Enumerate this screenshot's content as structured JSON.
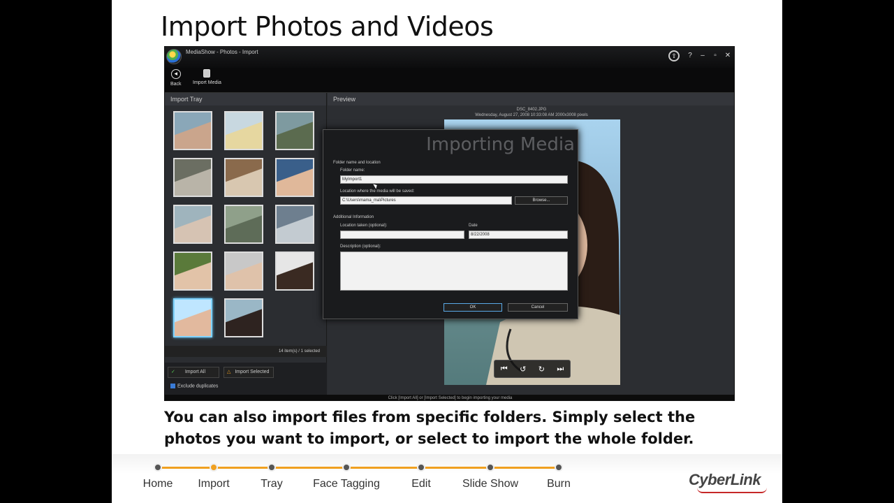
{
  "slide": {
    "title": "Import Photos and Videos"
  },
  "window": {
    "title": "MediaShow - Photos - Import",
    "controls": {
      "help": "?",
      "minimize": "–",
      "restore": "▫",
      "close": "✕"
    }
  },
  "toolbar": {
    "back_label": "Back",
    "import_media_label": "Import Media"
  },
  "tray": {
    "header": "Import Tray",
    "status": "14 item(s) / 1 selected",
    "import_all": "Import All",
    "import_selected": "Import Selected",
    "exclude_duplicates": "Exclude duplicates",
    "exclude_checked": true,
    "selected_index": 12
  },
  "preview": {
    "header": "Preview",
    "filename": "DSC_8402.JPG",
    "fileinfo": "Wednesday, August 27, 2008 10:33:08 AM 2000x3008 pixels",
    "hint": "Click [Import All] or [Import Selected] to begin importing your media"
  },
  "dialog": {
    "title": "Importing Media",
    "section_folder": "Folder name and location",
    "folder_name_label": "Folder name:",
    "folder_name_value": "MyImport1",
    "location_label": "Location where the media will be saved:",
    "location_value": "C:\\Users\\mama_ma\\Pictures",
    "browse": "Browse...",
    "section_additional": "Additional Information",
    "location_taken_label": "Location taken (optional):",
    "location_taken_value": "",
    "date_label": "Date",
    "date_value": "8/22/2008",
    "description_label": "Description (optional):",
    "description_value": "",
    "ok": "OK",
    "cancel": "Cancel"
  },
  "caption": "You can also import files from specific folders. Simply select the photos you want to import, or select to import the whole folder.",
  "nav": {
    "items": [
      "Home",
      "Import",
      "Tray",
      "Face Tagging",
      "Edit",
      "Slide Show",
      "Burn"
    ],
    "active_index": 1
  },
  "brand": {
    "logo_text": "CyberLink",
    "accent": "#f0a020",
    "logo_red": "#c62828"
  }
}
